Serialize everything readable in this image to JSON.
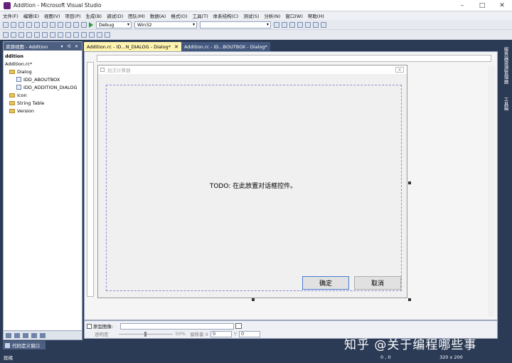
{
  "window": {
    "title": "Addition - Microsoft Visual Studio",
    "minimize": "–",
    "maximize": "□",
    "close": "✕"
  },
  "menu": [
    "文件(F)",
    "编辑(E)",
    "视图(V)",
    "项目(P)",
    "生成(B)",
    "调试(D)",
    "团队(M)",
    "数据(A)",
    "格式(O)",
    "工具(T)",
    "体系结构(C)",
    "测试(S)",
    "分析(N)",
    "窗口(W)",
    "帮助(H)"
  ],
  "toolbar": {
    "config": "Debug",
    "platform": "Win32",
    "find": ""
  },
  "resource_view": {
    "header": "资源视图 - Addition",
    "header_buttons": "▾ ᐊ ✕",
    "root": "ddition",
    "rc_file": "Addition.rc*",
    "tree": [
      {
        "label": "Dialog",
        "type": "folder",
        "level": 1
      },
      {
        "label": "IDD_ABOUTBOX",
        "type": "file",
        "level": 2
      },
      {
        "label": "IDD_ADDITION_DIALOG",
        "type": "file",
        "level": 2
      },
      {
        "label": "Icon",
        "type": "folder",
        "level": 1
      },
      {
        "label": "String Table",
        "type": "folder",
        "level": 1
      },
      {
        "label": "Version",
        "type": "folder",
        "level": 1
      }
    ]
  },
  "doc_tabs": [
    {
      "label": "Addition.rc - ID...N_DIALOG - Dialog*",
      "close": "✕"
    },
    {
      "label": "Addition.rc - ID...BOUTBOX - Dialog*"
    }
  ],
  "dialog": {
    "title": "加法计算器",
    "close": "✕",
    "todo_text": "TODO: 在此放置对话框控件。",
    "ok_label": "确定",
    "cancel_label": "取消"
  },
  "preview": {
    "checkbox_label": "原型图像:",
    "transparency_label": "透明度",
    "transparency_value": "50%",
    "offset_label": "偏移量 X",
    "x_value": "0",
    "y_label": "Y",
    "y_value": "0"
  },
  "right_tabs": [
    "服务器资源管理器",
    "工具箱"
  ],
  "code_def_tab": "代码定义窗口",
  "status": {
    "ready": "就绪",
    "position": "0 , 0",
    "size": "320 x 200"
  },
  "watermark": "知乎 @关于编程哪些事"
}
